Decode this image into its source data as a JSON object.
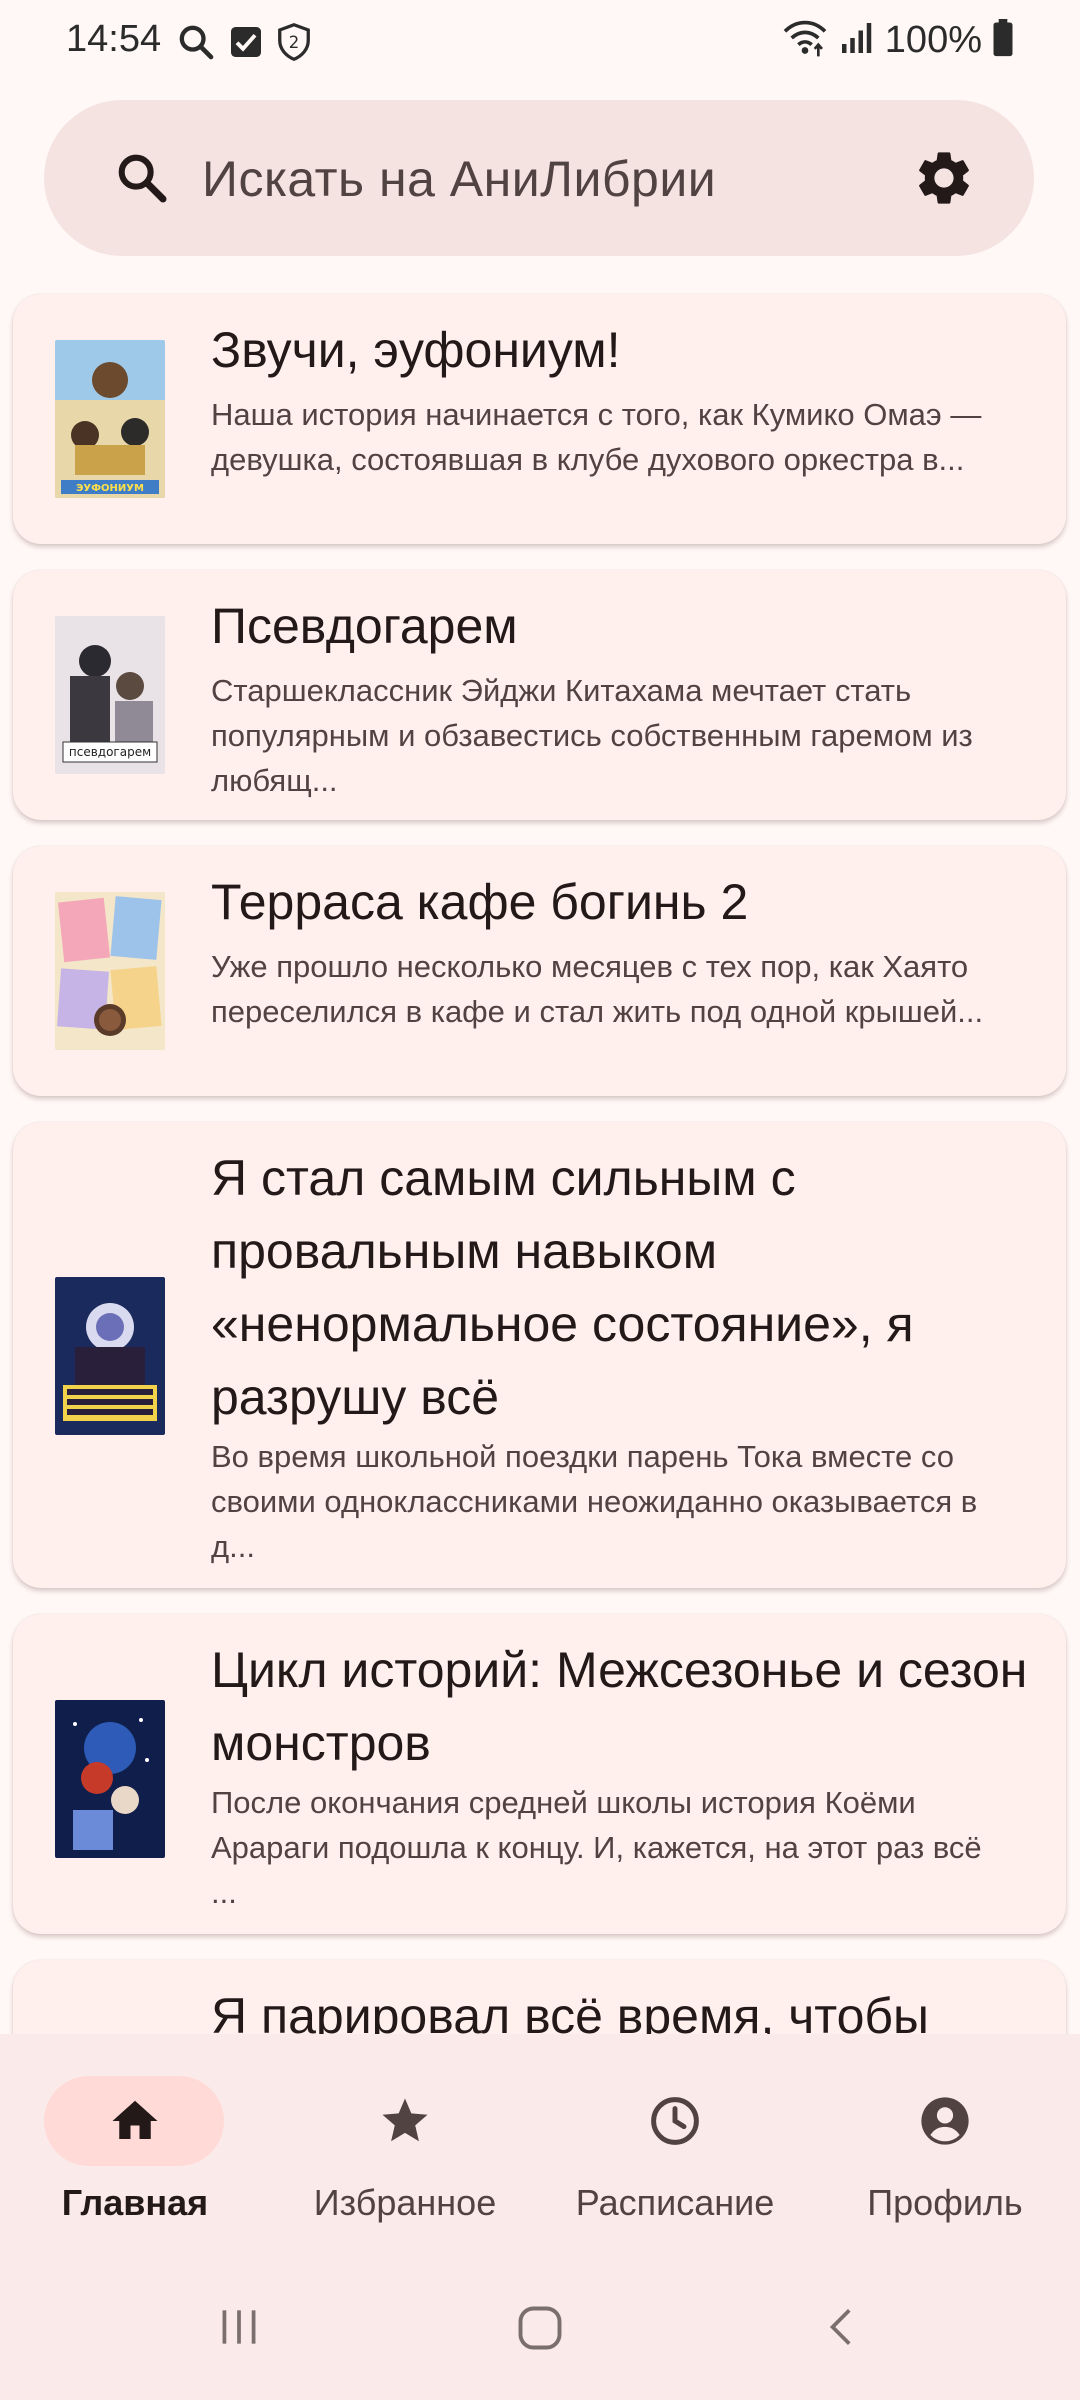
{
  "status_bar": {
    "time": "14:54",
    "battery": "100%",
    "icons": [
      "search-icon",
      "checkbox-icon",
      "shield-icon",
      "wifi-icon",
      "signal-icon",
      "battery-icon"
    ],
    "shield_badge": "2"
  },
  "search": {
    "placeholder": "Искать на АниЛибрии",
    "settings_icon": "gear-icon"
  },
  "releases": [
    {
      "title": "Звучи, эуфониум!",
      "description": "Наша история начинается с того, как Кумико Омаэ — девушка, состоявшая в клубе духового оркестра в...",
      "poster_caption": "ЭУФОНИУМ"
    },
    {
      "title": "Псевдогарем",
      "description": "Старшеклассник Эйджи Китахама мечтает стать популярным и обзавестись собственным гаремом из любящ...",
      "poster_caption": "псевдогарем"
    },
    {
      "title": "Терраса кафе богинь 2",
      "description": "Уже прошло несколько месяцев с тех пор, как Хаято переселился в кафе и стал жить под одной крышей..."
    },
    {
      "title": "Я стал самым сильным с провальным навыком «ненормальное состояние», я разрушу всё",
      "description": "Во время школьной поездки парень Тока вместе со своими одноклассниками неожиданно оказывается в д..."
    },
    {
      "title": "Цикл историй: Межсезонье и сезон монстров",
      "description": "После окончания средней школы история Коёми Арараги подошла к концу. И, кажется, на этот раз всё ..."
    },
    {
      "title": "Я парировал всё время, чтобы",
      "description": ""
    }
  ],
  "bottom_nav": {
    "items": [
      {
        "label": "Главная",
        "icon": "home-icon",
        "active": true
      },
      {
        "label": "Избранное",
        "icon": "star-icon",
        "active": false
      },
      {
        "label": "Расписание",
        "icon": "clock-icon",
        "active": false
      },
      {
        "label": "Профиль",
        "icon": "account-icon",
        "active": false
      }
    ]
  },
  "colors": {
    "background": "#fff8f6",
    "card": "#fff0ee",
    "search_bar": "#f5e3e1",
    "nav_active": "#ffdad6",
    "text": "#231919"
  }
}
